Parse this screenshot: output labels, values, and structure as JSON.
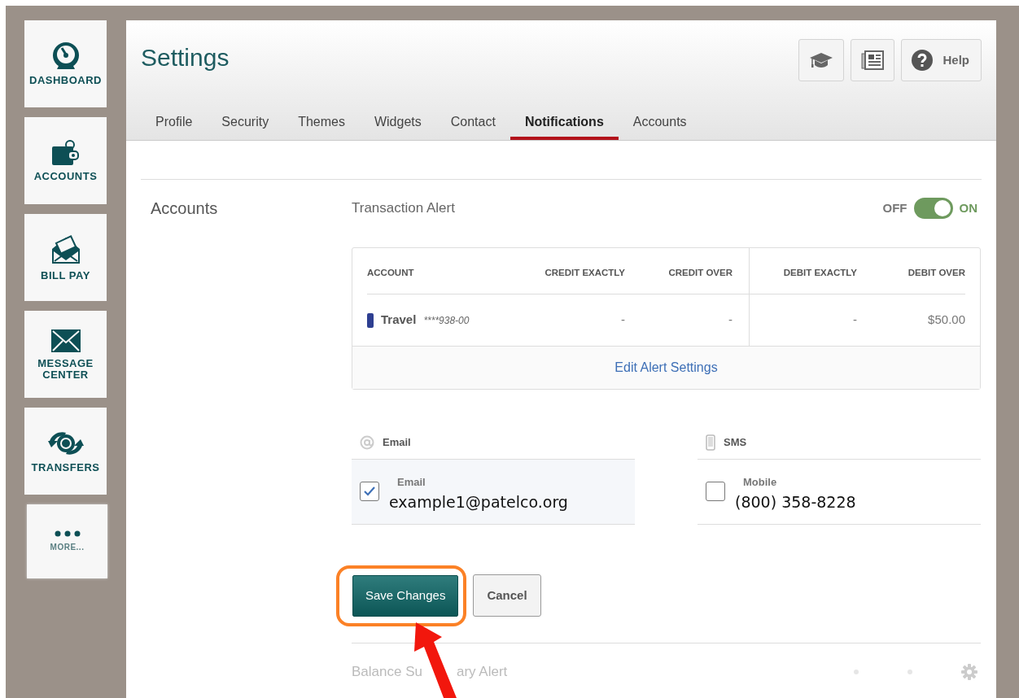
{
  "sidebar": {
    "items": [
      {
        "label": "DASHBOARD",
        "faded": false
      },
      {
        "label": "ACCOUNTS",
        "faded": false
      },
      {
        "label": "BILL PAY",
        "faded": false
      },
      {
        "label": "MESSAGE CENTER",
        "faded": false
      },
      {
        "label": "TRANSFERS",
        "faded": false
      },
      {
        "label": "MORE...",
        "faded": true
      }
    ]
  },
  "header": {
    "title": "Settings",
    "buttons": [
      {
        "kind": "tutorial"
      },
      {
        "kind": "news"
      },
      {
        "kind": "help",
        "label": "Help"
      }
    ]
  },
  "tabs": [
    {
      "label": "Profile",
      "selected": false
    },
    {
      "label": "Security",
      "selected": false
    },
    {
      "label": "Themes",
      "selected": false
    },
    {
      "label": "Widgets",
      "selected": false
    },
    {
      "label": "Contact",
      "selected": false
    },
    {
      "label": "Notifications",
      "selected": true
    },
    {
      "label": "Accounts",
      "selected": false
    }
  ],
  "section": "Accounts",
  "alert": {
    "title": "Transaction Alert",
    "toggle": {
      "off_label": "OFF",
      "on_label": "ON",
      "on": true
    },
    "table": {
      "columns": [
        "ACCOUNT",
        "CREDIT EXACTLY",
        "CREDIT OVER",
        "DEBIT EXACTLY",
        "DEBIT OVER"
      ],
      "rows": [
        {
          "cells": [
            {
              "text": "Travel",
              "note": "****938-00",
              "color": "#2e3f91"
            },
            {
              "text": "-"
            },
            {
              "text": "-"
            },
            {
              "text": "-"
            },
            {
              "text": "$50.00"
            }
          ]
        }
      ]
    },
    "edit_link": "Edit Alert Settings"
  },
  "channels": [
    {
      "heading": "Email",
      "field_label": "Email",
      "value": "example1@patelco.org",
      "checked": true
    },
    {
      "heading": "SMS",
      "field_label": "Mobile",
      "value": "(800) 358-8228",
      "checked": false
    }
  ],
  "buttons": [
    {
      "label": "Save Changes",
      "kind": "primary",
      "highlighted": true
    },
    {
      "label": "Cancel",
      "kind": "secondary",
      "highlighted": false
    }
  ],
  "next_alert": {
    "title_parts": [
      "Balance Su",
      "ary Alert"
    ]
  }
}
